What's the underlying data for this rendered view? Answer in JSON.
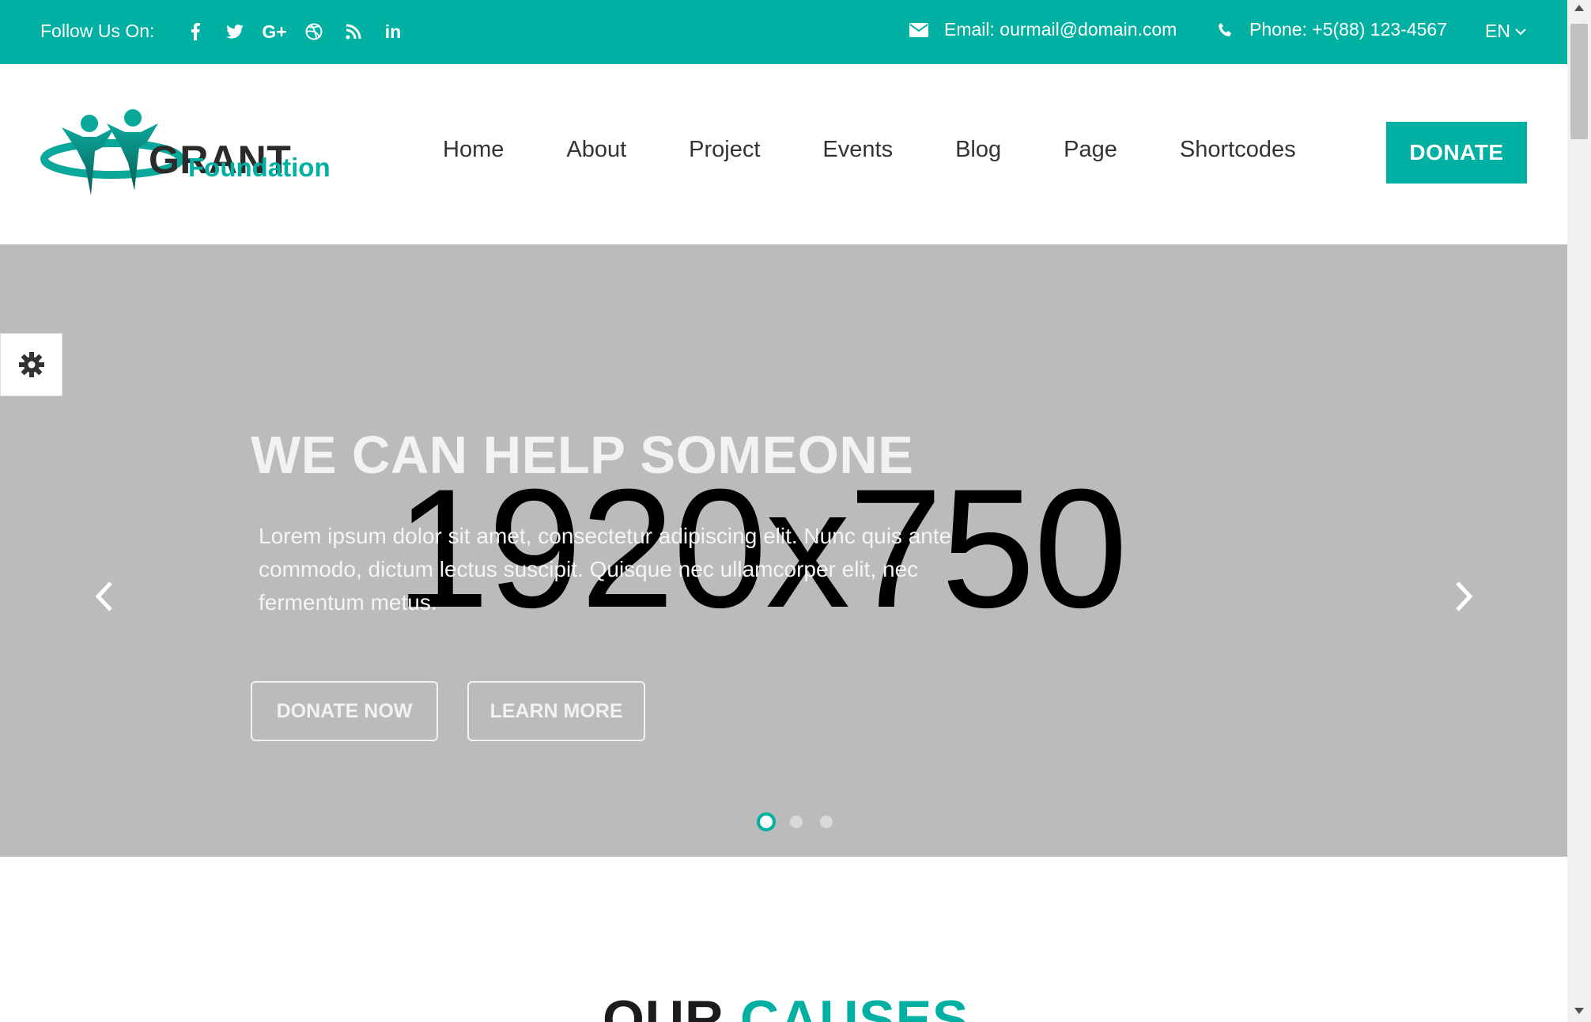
{
  "topbar": {
    "follow_label": "Follow Us On:",
    "social_icons": [
      "facebook-icon",
      "twitter-icon",
      "google-plus-icon",
      "dribbble-icon",
      "rss-icon",
      "linkedin-icon"
    ],
    "social_glyphs": [
      "f",
      "",
      "G+",
      "",
      "",
      "in"
    ],
    "email": "Email: ourmail@domain.com",
    "phone": "Phone: +5(88) 123-4567",
    "language": "EN"
  },
  "header": {
    "logo_title": "GRANT",
    "logo_subtitle": "Foundation",
    "nav": [
      "Home",
      "About",
      "Project",
      "Events",
      "Blog",
      "Page",
      "Shortcodes"
    ],
    "donate_label": "DONATE"
  },
  "hero": {
    "placeholder": "1920x750",
    "title": "WE CAN HELP SOMEONE",
    "description": "Lorem ipsum dolor sit amet, consectetur adipiscing elit. Nunc quis ante commodo, dictum lectus suscipit. Quisque nec ullamcorper elit, nec fermentum metus.",
    "buttons": [
      "DONATE NOW",
      "LEARN MORE"
    ],
    "slide_count": 3,
    "active_slide": 1
  },
  "section": {
    "title_part1": "OUR",
    "title_part2": "CAUSES"
  },
  "colors": {
    "accent": "#00b0a3",
    "hero_bg": "#bbbbbb",
    "dark_text": "#2b2b2b"
  }
}
